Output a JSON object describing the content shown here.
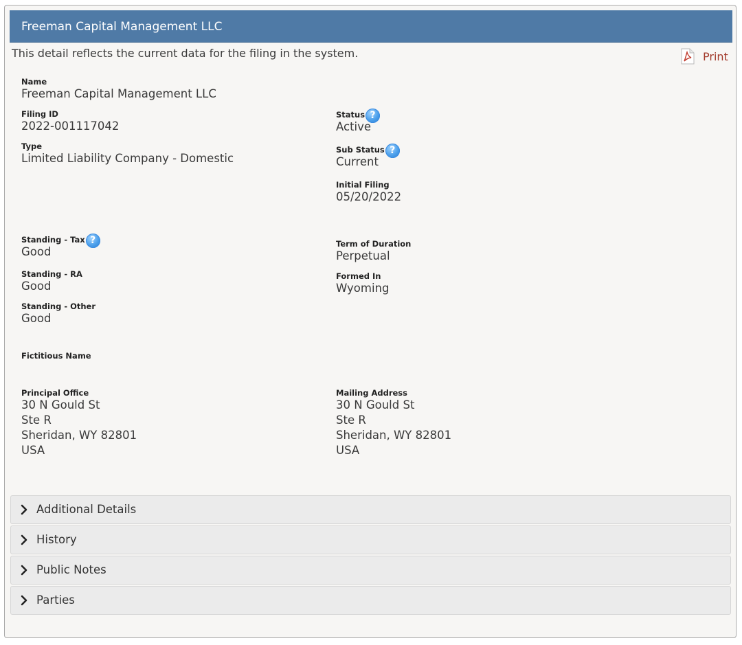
{
  "header": {
    "title": "Freeman Capital Management LLC"
  },
  "intro_text": "This detail reflects the current data for the filing in the system.",
  "print": {
    "label": "Print",
    "icon": "pdf-icon"
  },
  "fields": {
    "name": {
      "label": "Name",
      "value": "Freeman Capital Management LLC"
    },
    "filing_id": {
      "label": "Filing ID",
      "value": "2022-001117042"
    },
    "type": {
      "label": "Type",
      "value": "Limited Liability Company - Domestic"
    },
    "status": {
      "label": "Status",
      "value": "Active"
    },
    "sub_status": {
      "label": "Sub Status",
      "value": "Current"
    },
    "initial_filing": {
      "label": "Initial Filing",
      "value": "05/20/2022"
    },
    "standing_tax": {
      "label": "Standing - Tax",
      "value": "Good"
    },
    "standing_ra": {
      "label": "Standing - RA",
      "value": "Good"
    },
    "standing_other": {
      "label": "Standing - Other",
      "value": "Good"
    },
    "term_of_duration": {
      "label": "Term of Duration",
      "value": "Perpetual"
    },
    "formed_in": {
      "label": "Formed In",
      "value": "Wyoming"
    },
    "fictitious_name": {
      "label": "Fictitious Name",
      "value": ""
    }
  },
  "principal_office": {
    "label": "Principal Office",
    "lines": [
      "30 N Gould St",
      "Ste R",
      "Sheridan, WY 82801",
      "USA"
    ]
  },
  "mailing_address": {
    "label": "Mailing Address",
    "lines": [
      "30 N Gould St",
      "Ste R",
      "Sheridan, WY 82801",
      "USA"
    ]
  },
  "help_icon_glyph": "?",
  "accordions": [
    {
      "label": "Additional Details"
    },
    {
      "label": "History"
    },
    {
      "label": "Public Notes"
    },
    {
      "label": "Parties"
    }
  ],
  "colors": {
    "header_bg": "#4f7aa6",
    "panel_bg": "#f7f6f4",
    "print_link": "#a23a2b",
    "help_icon": "#4a9eea"
  }
}
